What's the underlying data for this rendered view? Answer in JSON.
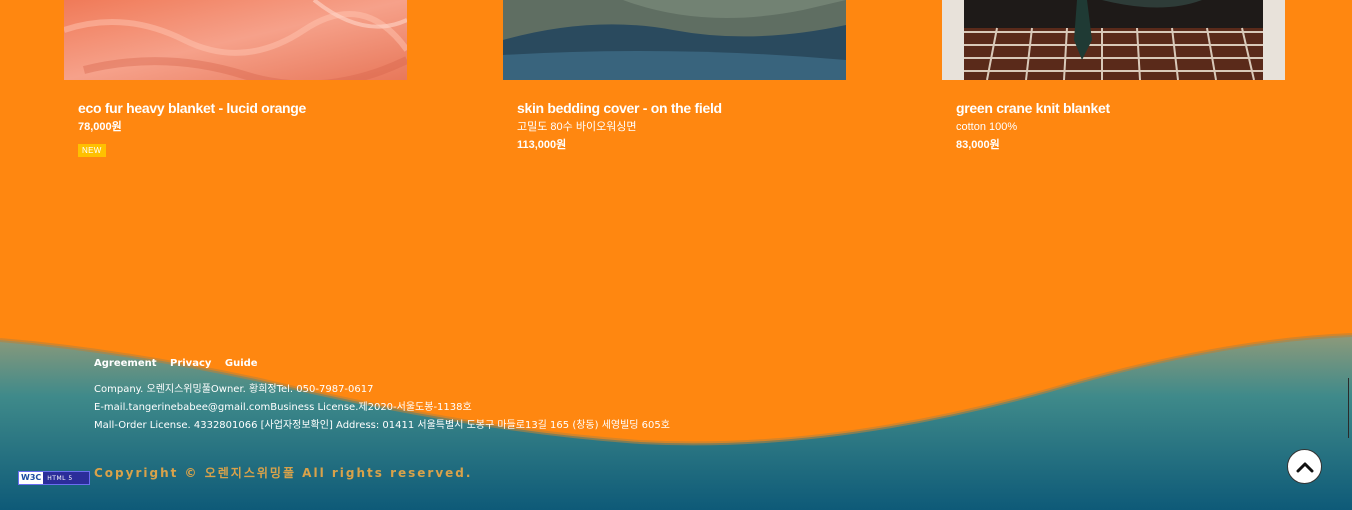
{
  "products": [
    {
      "name": "eco fur heavy blanket - lucid orange",
      "desc": "",
      "price": "78,000원",
      "badge": "NEW"
    },
    {
      "name": "skin bedding cover - on the field",
      "desc": "고밀도 80수 바이오워싱면",
      "price": "113,000원",
      "badge": ""
    },
    {
      "name": "green crane knit blanket",
      "desc": "cotton 100%",
      "price": "83,000원",
      "badge": ""
    }
  ],
  "footer": {
    "links": [
      "Agreement",
      "Privacy",
      "Guide"
    ],
    "company_line": "Company. 오렌지스위밍풀Owner. 황희정Tel. 050-7987-0617",
    "email_line": "E-mail.tangerinebabee@gmail.comBusiness License.제2020-서울도봉-1138호",
    "order_line": "Mall-Order License. 4332801066 [사업자정보확인] Address: 01411 서울특별시 도봉구 마들로13길 165 (창동) 세영빌딩 605호",
    "copyright": "Copyright © 오렌지스위밍풀 All rights reserved."
  },
  "w3c_badge": {
    "logo": "W3C",
    "label": "HTML 5"
  },
  "icons": {
    "top_button": "chevron-up-icon"
  },
  "colors": {
    "background": "#ff8710",
    "wave_teal": "#1c6b82",
    "copyright": "#d9a24a",
    "badge": "#ffc000"
  }
}
